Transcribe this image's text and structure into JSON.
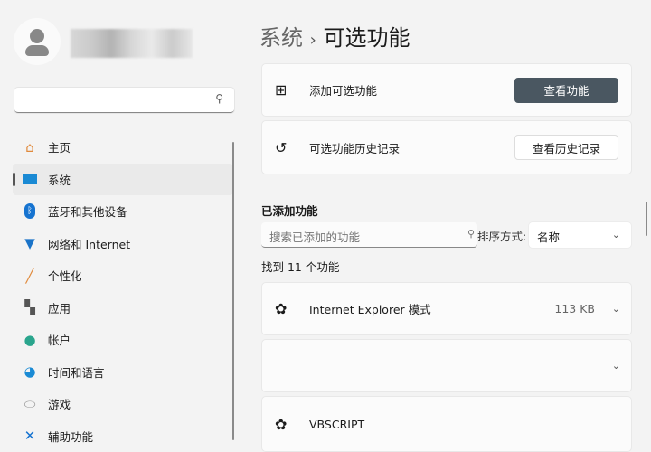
{
  "sidebar": {
    "search_placeholder": "",
    "items": [
      {
        "label": "主页",
        "icon": "home-icon"
      },
      {
        "label": "系统",
        "icon": "system-icon"
      },
      {
        "label": "蓝牙和其他设备",
        "icon": "bluetooth-icon"
      },
      {
        "label": "网络和 Internet",
        "icon": "wifi-icon"
      },
      {
        "label": "个性化",
        "icon": "brush-icon"
      },
      {
        "label": "应用",
        "icon": "apps-icon"
      },
      {
        "label": "帐户",
        "icon": "account-icon"
      },
      {
        "label": "时间和语言",
        "icon": "time-language-icon"
      },
      {
        "label": "游戏",
        "icon": "gamepad-icon"
      },
      {
        "label": "辅助功能",
        "icon": "accessibility-icon"
      }
    ]
  },
  "header": {
    "crumb": "系统",
    "sep": "›",
    "title": "可选功能"
  },
  "add": {
    "label": "添加可选功能",
    "button": "查看功能"
  },
  "history": {
    "label": "可选功能历史记录",
    "button": "查看历史记录"
  },
  "added": {
    "heading": "已添加功能",
    "search_placeholder": "搜索已添加的功能",
    "sort_label": "排序方式:",
    "sort_value": "名称",
    "count": "找到 11 个功能",
    "features": [
      {
        "name": "Internet Explorer 模式",
        "size": "113 KB"
      },
      {
        "name": "",
        "size": ""
      },
      {
        "name": "VBSCRIPT",
        "size": ""
      }
    ]
  }
}
